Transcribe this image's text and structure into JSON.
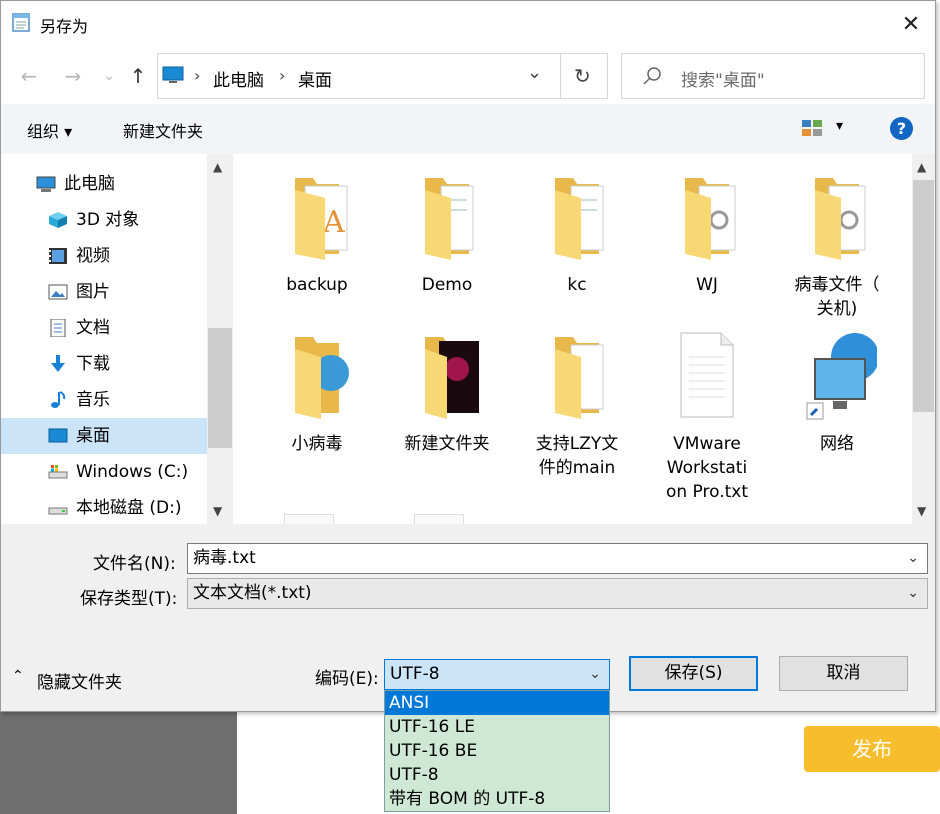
{
  "window": {
    "title": "另存为",
    "close": "✕"
  },
  "nav_buttons": {
    "back": "←",
    "forward": "→",
    "recent": "⌄",
    "up": "↑"
  },
  "address": {
    "crumbs": [
      "此电脑",
      "桌面"
    ],
    "separator": "›",
    "dropdown": "⌄",
    "refresh": "↻"
  },
  "search": {
    "placeholder": "搜索\"桌面\""
  },
  "toolbar": {
    "organize": "组织 ▾",
    "new_folder": "新建文件夹",
    "view_arrow": "▾",
    "help": "?"
  },
  "nav_pane": {
    "items": [
      {
        "label": "此电脑",
        "icon": "computer-icon"
      },
      {
        "label": "3D 对象",
        "icon": "cube-icon"
      },
      {
        "label": "视频",
        "icon": "video-icon"
      },
      {
        "label": "图片",
        "icon": "picture-icon"
      },
      {
        "label": "文档",
        "icon": "document-icon"
      },
      {
        "label": "下载",
        "icon": "download-icon"
      },
      {
        "label": "音乐",
        "icon": "music-icon"
      },
      {
        "label": "桌面",
        "icon": "desktop-icon",
        "selected": true
      },
      {
        "label": "Windows (C:)",
        "icon": "drive-icon"
      },
      {
        "label": "本地磁盘 (D:)",
        "icon": "drive-icon"
      }
    ]
  },
  "files": [
    {
      "name": "backup",
      "type": "folder"
    },
    {
      "name": "Demo",
      "type": "folder"
    },
    {
      "name": "kc",
      "type": "folder"
    },
    {
      "name": "WJ",
      "type": "folder"
    },
    {
      "name": "病毒文件（\n关机)",
      "type": "folder"
    },
    {
      "name": "小病毒",
      "type": "folder"
    },
    {
      "name": "新建文件夹",
      "type": "folder"
    },
    {
      "name": "支持LZY文\n件的main",
      "type": "folder"
    },
    {
      "name": "VMware\nWorkstati\non Pro.txt",
      "type": "text-file"
    },
    {
      "name": "网络",
      "type": "network-shortcut"
    }
  ],
  "form": {
    "filename_label": "文件名(N):",
    "filename_value": "病毒.txt",
    "filetype_label": "保存类型(T):",
    "filetype_value": "文本文档(*.txt)",
    "hide_folders": "隐藏文件夹",
    "encoding_label": "编码(E):",
    "encoding_value": "UTF-8",
    "save": "保存(S)",
    "cancel": "取消"
  },
  "encoding_options": [
    "ANSI",
    "UTF-16 LE",
    "UTF-16 BE",
    "UTF-8",
    "带有 BOM 的 UTF-8"
  ],
  "background": {
    "publish_button": "发布"
  },
  "colors": {
    "accent": "#0078d7",
    "publish": "#f7bd2c",
    "dropdown_bg": "#cfe8d5",
    "folder": "#f8d775"
  }
}
